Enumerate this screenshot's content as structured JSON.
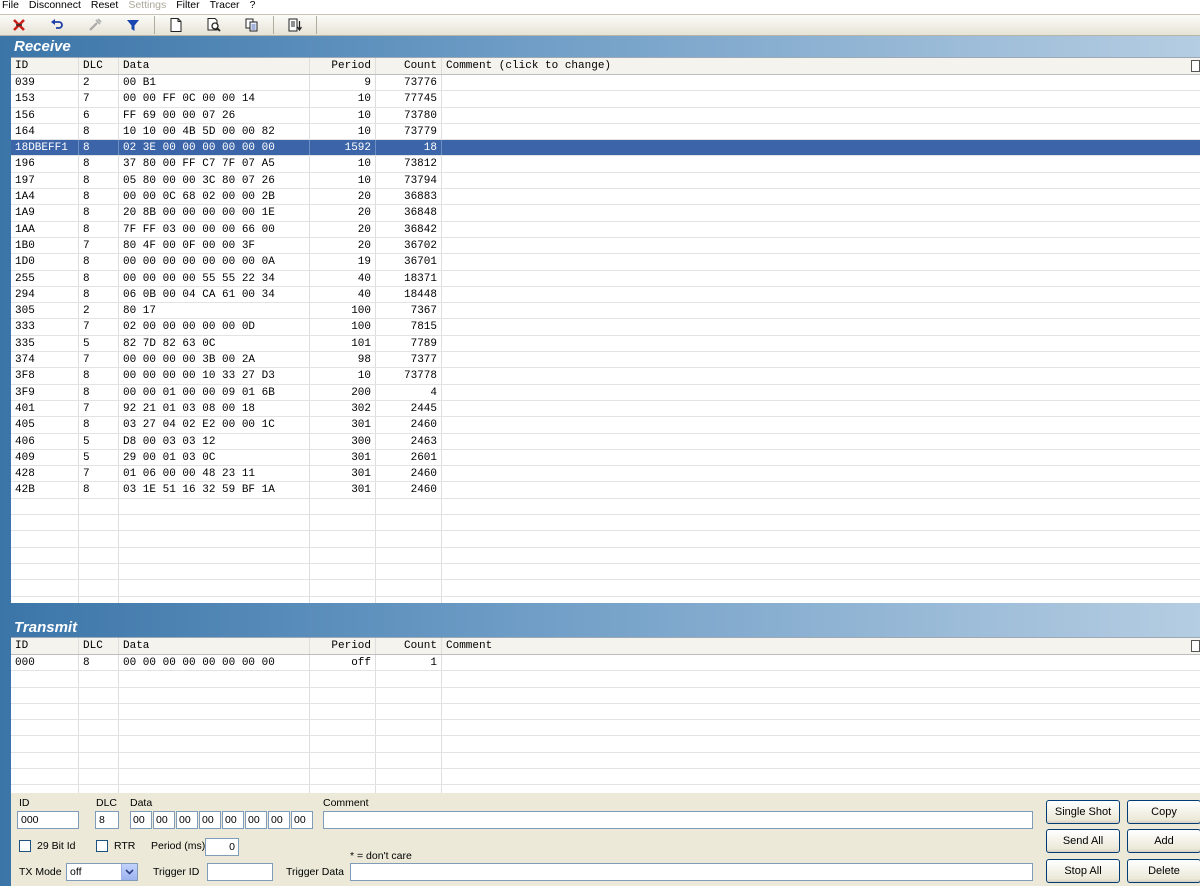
{
  "menu": [
    "File",
    "Disconnect",
    "Reset",
    "Settings",
    "Filter",
    "Tracer",
    "?"
  ],
  "menu_disabled": "Settings",
  "toolbar_icons": [
    "disconnect-icon",
    "undo-icon",
    "settings-tools-icon",
    "filter-icon",
    "new-document-icon",
    "print-preview-icon",
    "copy-icon",
    "export-icon"
  ],
  "columns": {
    "id": "ID",
    "dlc": "DLC",
    "data": "Data",
    "period": "Period",
    "count": "Count",
    "comment_receive": "Comment (click to change)",
    "comment_transmit": "Comment"
  },
  "receive": {
    "title": "Receive",
    "rows": [
      {
        "id": "039",
        "dlc": "2",
        "data": "00 B1",
        "period": "9",
        "count": "73776"
      },
      {
        "id": "153",
        "dlc": "7",
        "data": "00 00 FF 0C 00 00 14",
        "period": "10",
        "count": "77745"
      },
      {
        "id": "156",
        "dlc": "6",
        "data": "FF 69 00 00 07 26",
        "period": "10",
        "count": "73780"
      },
      {
        "id": "164",
        "dlc": "8",
        "data": "10 10 00 4B 5D 00 00 82",
        "period": "10",
        "count": "73779"
      },
      {
        "id": "18DBEFF1",
        "dlc": "8",
        "data": "02 3E 00 00 00 00 00 00",
        "period": "1592",
        "count": "18",
        "selected": true
      },
      {
        "id": "196",
        "dlc": "8",
        "data": "37 80 00 FF C7 7F 07 A5",
        "period": "10",
        "count": "73812"
      },
      {
        "id": "197",
        "dlc": "8",
        "data": "05 80 00 00 3C 80 07 26",
        "period": "10",
        "count": "73794"
      },
      {
        "id": "1A4",
        "dlc": "8",
        "data": "00 00 0C 68 02 00 00 2B",
        "period": "20",
        "count": "36883"
      },
      {
        "id": "1A9",
        "dlc": "8",
        "data": "20 8B 00 00 00 00 00 1E",
        "period": "20",
        "count": "36848"
      },
      {
        "id": "1AA",
        "dlc": "8",
        "data": "7F FF 03 00 00 00 66 00",
        "period": "20",
        "count": "36842"
      },
      {
        "id": "1B0",
        "dlc": "7",
        "data": "80 4F 00 0F 00 00 3F",
        "period": "20",
        "count": "36702"
      },
      {
        "id": "1D0",
        "dlc": "8",
        "data": "00 00 00 00 00 00 00 0A",
        "period": "19",
        "count": "36701"
      },
      {
        "id": "255",
        "dlc": "8",
        "data": "00 00 00 00 55 55 22 34",
        "period": "40",
        "count": "18371"
      },
      {
        "id": "294",
        "dlc": "8",
        "data": "06 0B 00 04 CA 61 00 34",
        "period": "40",
        "count": "18448"
      },
      {
        "id": "305",
        "dlc": "2",
        "data": "80 17",
        "period": "100",
        "count": "7367"
      },
      {
        "id": "333",
        "dlc": "7",
        "data": "02 00 00 00 00 00 0D",
        "period": "100",
        "count": "7815"
      },
      {
        "id": "335",
        "dlc": "5",
        "data": "82 7D 82 63 0C",
        "period": "101",
        "count": "7789"
      },
      {
        "id": "374",
        "dlc": "7",
        "data": "00 00 00 00 3B 00 2A",
        "period": "98",
        "count": "7377"
      },
      {
        "id": "3F8",
        "dlc": "8",
        "data": "00 00 00 00 10 33 27 D3",
        "period": "10",
        "count": "73778"
      },
      {
        "id": "3F9",
        "dlc": "8",
        "data": "00 00 01 00 00 09 01 6B",
        "period": "200",
        "count": "4"
      },
      {
        "id": "401",
        "dlc": "7",
        "data": "92 21 01 03 08 00 18",
        "period": "302",
        "count": "2445"
      },
      {
        "id": "405",
        "dlc": "8",
        "data": "03 27 04 02 E2 00 00 1C",
        "period": "301",
        "count": "2460"
      },
      {
        "id": "406",
        "dlc": "5",
        "data": "D8 00 03 03 12",
        "period": "300",
        "count": "2463"
      },
      {
        "id": "409",
        "dlc": "5",
        "data": "29 00 01 03 0C",
        "period": "301",
        "count": "2601"
      },
      {
        "id": "428",
        "dlc": "7",
        "data": "01 06 00 00 48 23 11",
        "period": "301",
        "count": "2460"
      },
      {
        "id": "42B",
        "dlc": "8",
        "data": "03 1E 51 16 32 59 BF 1A",
        "period": "301",
        "count": "2460"
      }
    ]
  },
  "transmit": {
    "title": "Transmit",
    "rows": [
      {
        "id": "000",
        "dlc": "8",
        "data": "00 00 00 00 00 00 00 00",
        "period": "off",
        "count": "1"
      }
    ]
  },
  "editor": {
    "id_label": "ID",
    "id_value": "000",
    "dlc_label": "DLC",
    "dlc_value": "8",
    "data_label": "Data",
    "data_bytes": [
      "00",
      "00",
      "00",
      "00",
      "00",
      "00",
      "00",
      "00"
    ],
    "comment_label": "Comment",
    "comment_value": "",
    "bit29_label": "29 Bit Id",
    "rtr_label": "RTR",
    "period_label": "Period (ms)",
    "period_value": "0",
    "dont_care_note": "* = don't care",
    "tx_mode_label": "TX Mode",
    "tx_mode_value": "off",
    "trigger_id_label": "Trigger ID",
    "trigger_id_value": "",
    "trigger_data_label": "Trigger Data",
    "trigger_data_value": ""
  },
  "buttons": {
    "single_shot": "Single Shot",
    "copy": "Copy",
    "send_all": "Send All",
    "add": "Add",
    "stop_all": "Stop All",
    "delete": "Delete"
  }
}
